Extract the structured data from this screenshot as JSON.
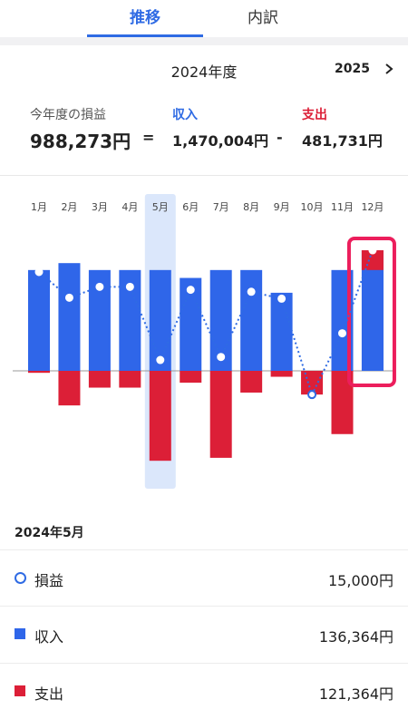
{
  "tabs": [
    {
      "label": "推移",
      "active": true
    },
    {
      "label": "内訳",
      "active": false
    }
  ],
  "year": {
    "title": "2024年度",
    "next": "2025"
  },
  "summary": {
    "profit_label": "今年度の損益",
    "profit_value": "988,273円",
    "income_label": "収入",
    "income_value": "1,470,004円",
    "expense_label": "支出",
    "expense_value": "481,731円",
    "equals": "=",
    "minus": "-"
  },
  "colors": {
    "income": "#2f66e9",
    "expense": "#dc1f37",
    "accent": "#2f6be4",
    "highlight_column": "#dbe7fb",
    "highlight_box": "#ec1e5c"
  },
  "chart_data": {
    "type": "bar",
    "categories": [
      "1月",
      "2月",
      "3月",
      "4月",
      "5月",
      "6月",
      "7月",
      "8月",
      "9月",
      "10月",
      "11月",
      "12月"
    ],
    "series": [
      {
        "name": "収入",
        "values": [
          102000,
          109000,
          102000,
          102000,
          102000,
          94000,
          102000,
          102000,
          79000,
          0,
          102000,
          122000
        ]
      },
      {
        "name": "支出",
        "values": [
          2000,
          35000,
          17000,
          17000,
          91000,
          12000,
          88000,
          22000,
          6000,
          24000,
          64000,
          20000
        ]
      },
      {
        "name": "損益",
        "values": [
          100000,
          74000,
          85000,
          85000,
          11000,
          82000,
          14000,
          80000,
          73000,
          -24000,
          38000,
          122000
        ]
      }
    ],
    "selected_index": 4,
    "highlighted_index": 11
  },
  "detail": {
    "title": "2024年5月",
    "rows": [
      {
        "icon": "circle-icon",
        "label": "損益",
        "value": "15,000円"
      },
      {
        "icon": "square-blue-icon",
        "label": "収入",
        "value": "136,364円"
      },
      {
        "icon": "square-red-icon",
        "label": "支出",
        "value": "121,364円"
      }
    ]
  }
}
